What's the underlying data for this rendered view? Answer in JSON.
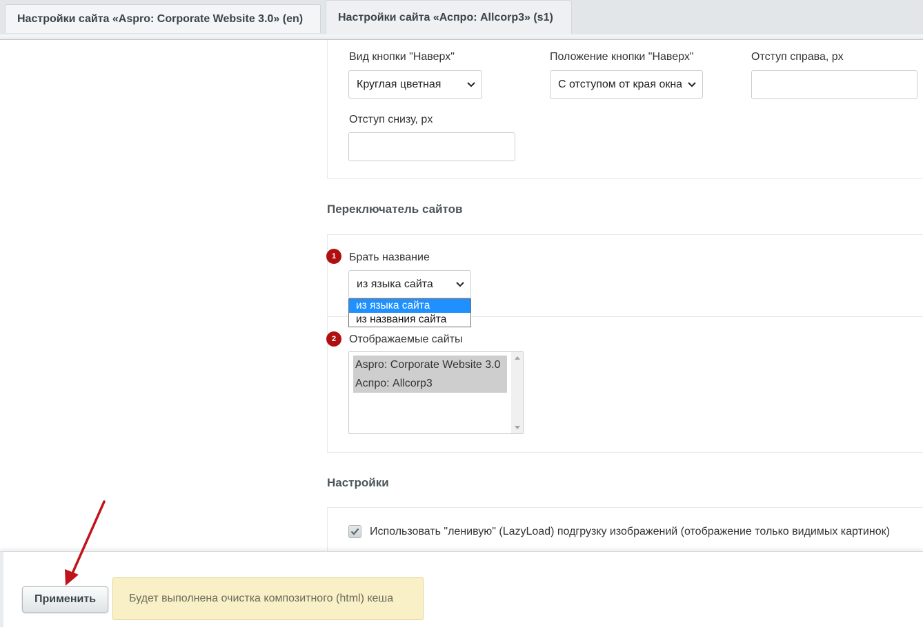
{
  "tabs": [
    {
      "label": "Настройки сайта «Aspro: Corporate Website 3.0» (en)"
    },
    {
      "label": "Настройки сайта «Аспро: Allcorp3» (s1)"
    }
  ],
  "scroll_top": {
    "button_type": {
      "label": "Вид кнопки \"Наверх\"",
      "value": "Круглая цветная"
    },
    "button_position": {
      "label": "Положение кнопки \"Наверх\"",
      "value": "С отступом от края окна"
    },
    "offset_right": {
      "label": "Отступ справа, px",
      "value": ""
    },
    "offset_bottom": {
      "label": "Отступ снизу, px",
      "value": ""
    }
  },
  "site_switcher": {
    "title": "Переключатель сайтов",
    "take_name": {
      "badge": "1",
      "label": "Брать название",
      "value": "из языка сайта",
      "options": [
        "из языка сайта",
        "из названия сайта"
      ]
    },
    "shown_sites": {
      "badge": "2",
      "label": "Отображаемые сайты",
      "items": [
        "Aspro: Corporate Website 3.0",
        "Аспро: Allcorp3"
      ]
    }
  },
  "settings": {
    "title": "Настройки",
    "lazyload_label": "Использовать \"ленивую\" (LazyLoad) подгрузку изображений (отображение только видимых картинок)",
    "lazyload_checked": true
  },
  "footer": {
    "apply_label": "Применить",
    "notice": "Будет выполнена очистка композитного (html) кеша"
  },
  "colors": {
    "badge": "#b00f10",
    "selected_option": "#1e90ff",
    "notice_bg": "#f9f0c7",
    "annotation_arrow": "#c0141b"
  }
}
